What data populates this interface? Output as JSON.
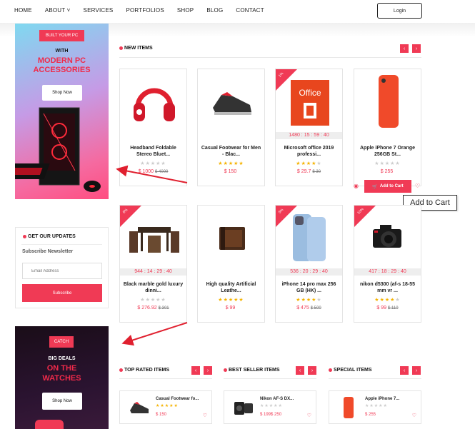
{
  "nav": {
    "items": [
      "HOME",
      "ABOUT ˅",
      "SERVICES",
      "PORTFOLIOS",
      "SHOP",
      "BLOG",
      "CONTACT"
    ],
    "login": "Login"
  },
  "banner1": {
    "tag": "BUILT YOUR PC",
    "with": "WITH",
    "headline1": "MODERN PC",
    "headline2": "ACCESSORIES",
    "button": "Shop Now"
  },
  "subscribe": {
    "title": "GET OUR UPDATES",
    "subtitle": "Subscribe Newsletter",
    "placeholder": "Email Address",
    "button": "Subscribe"
  },
  "banner2": {
    "tag": "CATCH",
    "small": "BIG DEALS",
    "headline1": "ON THE",
    "headline2": "WATCHES",
    "button": "Shop Now"
  },
  "new_items": {
    "title": "NEW ITEMS",
    "prev": "‹",
    "next": "›",
    "products": [
      {
        "name": "Headband Foldable Stereo Bluet...",
        "price": "$ 1000",
        "old": "$ 4000",
        "timer": "",
        "ribbon": "",
        "stars": 0
      },
      {
        "name": "Casual Footwear for Men - Blac...",
        "price": "$ 150",
        "old": "",
        "timer": "",
        "ribbon": "",
        "stars": 5
      },
      {
        "name": "Microsoft office 2019 professi...",
        "price": "$ 29.7",
        "old": "$ 30",
        "timer": "1480 : 15 : 59 : 40",
        "ribbon": "1%",
        "stars": 4
      },
      {
        "name": "Apple iPhone 7 Orange 256GB St...",
        "price": "$ 255",
        "old": "",
        "timer": "",
        "ribbon": "",
        "stars": 0
      },
      {
        "name": "Black marble gold luxury dinni...",
        "price": "$ 276.92",
        "old": "$ 301",
        "timer": "944 : 14 : 29 : 40",
        "ribbon": "8%",
        "stars": 0
      },
      {
        "name": "High quality Artificial Leathe...",
        "price": "$ 99",
        "old": "",
        "timer": "",
        "ribbon": "",
        "stars": 5
      },
      {
        "name": "iPhone 14 pro max 256 GB (HK) ...",
        "price": "$ 475",
        "old": "$ 500",
        "timer": "536 : 20 : 29 : 40",
        "ribbon": "5%",
        "stars": 4
      },
      {
        "name": "nikon d5300 (af-s 18-55 mm vr ...",
        "price": "$ 99",
        "old": "$ 110",
        "timer": "417 : 18 : 29 : 40",
        "ribbon": "10%",
        "stars": 4
      }
    ],
    "add_to_cart": "Add to Cart",
    "tooltip": "Add to Cart"
  },
  "bottom_sections": [
    {
      "title": "TOP RATED ITEMS",
      "item": {
        "name": "Casual Footwear fo...",
        "price": "$ 150",
        "old": "",
        "stars": 5
      }
    },
    {
      "title": "BEST SELLER ITEMS",
      "item": {
        "name": "Nikon AF-S DX...",
        "price": "$ 199",
        "old": "$ 250",
        "stars": 0
      }
    },
    {
      "title": "SPECIAL ITEMS",
      "item": {
        "name": "Apple iPhone 7...",
        "price": "$ 255",
        "old": "",
        "stars": 0
      }
    }
  ],
  "colors": {
    "accent": "#f03a55",
    "star": "#f5b301"
  }
}
